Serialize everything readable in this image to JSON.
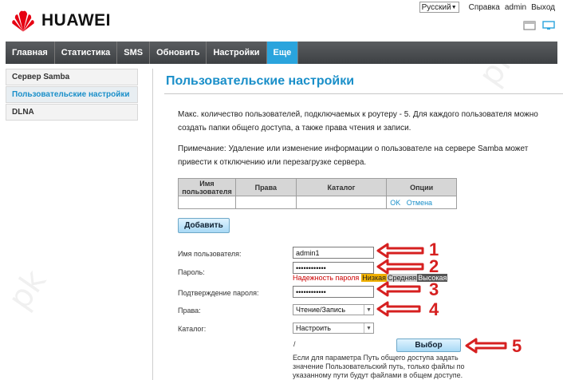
{
  "brand": {
    "name": "HUAWEI",
    "color": "#e60012"
  },
  "toplinks": {
    "language": "Русский",
    "help": "Справка",
    "user": "admin",
    "logout": "Выход"
  },
  "top_icons": [
    "window-icon",
    "monitor-icon"
  ],
  "nav": {
    "items": [
      {
        "label": "Главная",
        "active": false
      },
      {
        "label": "Статистика",
        "active": false
      },
      {
        "label": "SMS",
        "active": false
      },
      {
        "label": "Обновить",
        "active": false
      },
      {
        "label": "Настройки",
        "active": false
      },
      {
        "label": "Еще",
        "active": true
      }
    ],
    "accent": "#2aa4dd"
  },
  "sidebar": {
    "items": [
      {
        "label": "Сервер Samba",
        "active": false
      },
      {
        "label": "Пользовательские настройки",
        "active": true
      },
      {
        "label": "DLNA",
        "active": false
      }
    ]
  },
  "main": {
    "title": "Пользовательские настройки",
    "intro_line1": "Макс. количество пользователей, подключаемых к роутеру - 5. Для каждого пользователя можно",
    "intro_line2": "создать папки общего доступа, а также права чтения и записи.",
    "note_line1": "Примечание: Удаление или изменение информации о пользователе на сервере Samba может",
    "note_line2": "привести к отключению или перезагрузке сервера.",
    "table": {
      "headers": [
        "Имя пользователя",
        "Права",
        "Каталог",
        "Опции"
      ],
      "row": {
        "ok": "OK",
        "cancel": "Отмена"
      }
    },
    "add_button": "Добавить",
    "form": {
      "username_label": "Имя пользователя:",
      "username_value": "admin1",
      "password_label": "Пароль:",
      "password_value": "••••••••••••",
      "strength_label": "Надежность пароля",
      "strength_low": "Низкая",
      "strength_mid": "Средняя",
      "strength_high": "Высокая",
      "confirm_label": "Подтверждение пароля:",
      "confirm_value": "••••••••••••",
      "rights_label": "Права:",
      "rights_value": "Чтение/Запись",
      "folder_label": "Каталог:",
      "folder_value": "Настроить",
      "path_value": "/",
      "select_button": "Выбор",
      "note": "Если для параметра Путь общего доступа задать значение Пользовательский путь, только файлы по указанному пути будут файлами в общем доступе."
    }
  },
  "annotations": [
    "1",
    "2",
    "3",
    "4",
    "5"
  ],
  "annotation_color": "#d62020"
}
